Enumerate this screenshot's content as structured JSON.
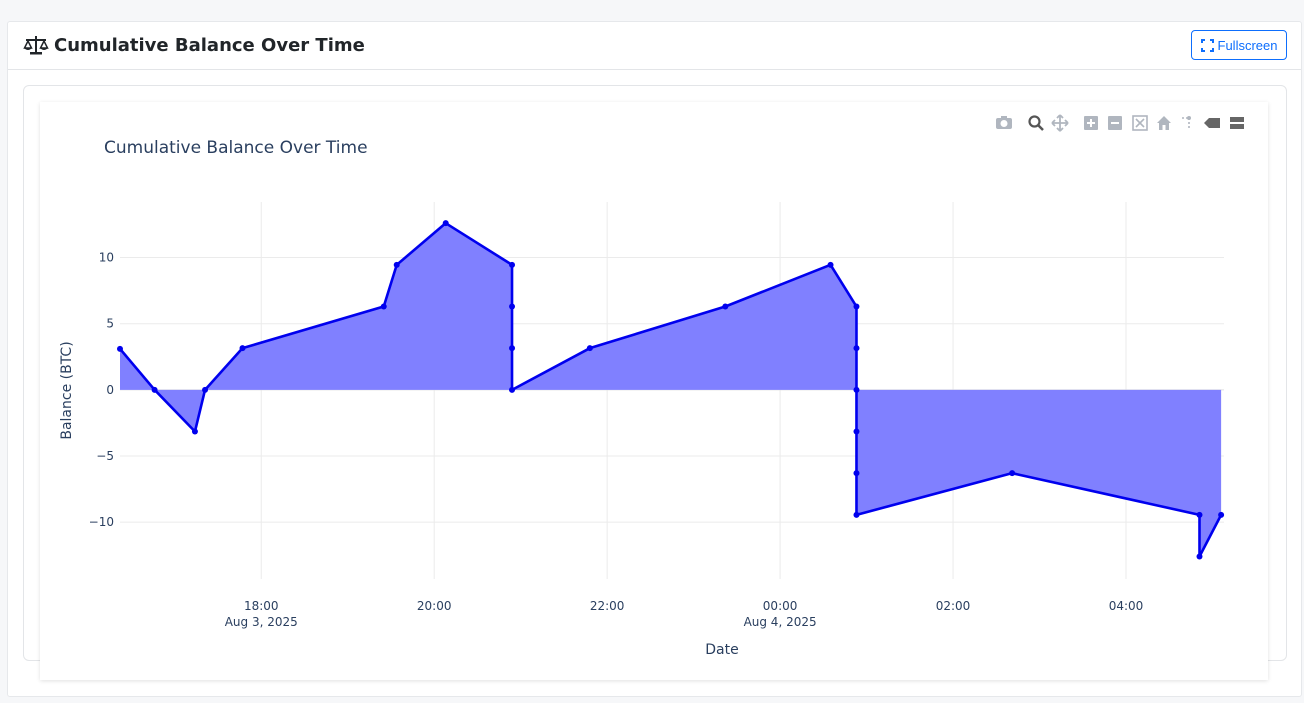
{
  "header": {
    "title": "Cumulative Balance Over Time",
    "icon": "scale-balance-icon",
    "fullscreen_label": "Fullscreen"
  },
  "modebar": [
    "camera-icon",
    "zoom-icon",
    "pan-icon",
    "zoom-in-icon",
    "zoom-out-icon",
    "autoscale-icon",
    "home-icon",
    "spike-lines-icon",
    "hover-closest-icon",
    "hover-compare-icon"
  ],
  "chart_data": {
    "type": "area",
    "title": "Cumulative Balance Over Time",
    "xlabel": "Date",
    "ylabel": "Balance (BTC)",
    "x_ticks": [
      {
        "t": "2025-08-03 18:00",
        "l1": "18:00",
        "l2": "Aug 3, 2025"
      },
      {
        "t": "2025-08-03 20:00",
        "l1": "20:00",
        "l2": ""
      },
      {
        "t": "2025-08-03 22:00",
        "l1": "22:00",
        "l2": ""
      },
      {
        "t": "2025-08-04 00:00",
        "l1": "00:00",
        "l2": "Aug 4, 2025"
      },
      {
        "t": "2025-08-04 02:00",
        "l1": "02:00",
        "l2": ""
      },
      {
        "t": "2025-08-04 04:00",
        "l1": "04:00",
        "l2": ""
      }
    ],
    "y_ticks": [
      10,
      5,
      0,
      -5,
      -10
    ],
    "y_tick_labels": [
      "10",
      "5",
      "0",
      "−5",
      "−10"
    ],
    "xlim": [
      "2025-08-03 16:22",
      "2025-08-04 05:08"
    ],
    "ylim": [
      -14.3,
      14.2
    ],
    "color": "#0000ee",
    "fill_color": "#8080ff",
    "series": [
      {
        "x": [
          "2025-08-03 16:22",
          "2025-08-03 16:46",
          "2025-08-03 17:14",
          "2025-08-03 17:21",
          "2025-08-03 17:47",
          "2025-08-03 19:25",
          "2025-08-03 19:34",
          "2025-08-03 20:08",
          "2025-08-03 20:54",
          "2025-08-03 20:54",
          "2025-08-03 20:54",
          "2025-08-03 20:54",
          "2025-08-03 21:48",
          "2025-08-03 23:22",
          "2025-08-04 00:35",
          "2025-08-04 00:53",
          "2025-08-04 00:53",
          "2025-08-04 00:53",
          "2025-08-04 00:53",
          "2025-08-04 00:53",
          "2025-08-04 00:53",
          "2025-08-04 02:41",
          "2025-08-04 04:51",
          "2025-08-04 04:51",
          "2025-08-04 05:06"
        ],
        "y": [
          3.1,
          0,
          -3.15,
          0,
          3.15,
          6.3,
          9.45,
          12.6,
          9.45,
          6.3,
          3.15,
          0,
          3.15,
          6.3,
          9.45,
          6.3,
          3.15,
          0,
          -3.15,
          -6.3,
          -9.45,
          -6.3,
          -9.45,
          -12.6,
          -9.45
        ]
      }
    ]
  }
}
